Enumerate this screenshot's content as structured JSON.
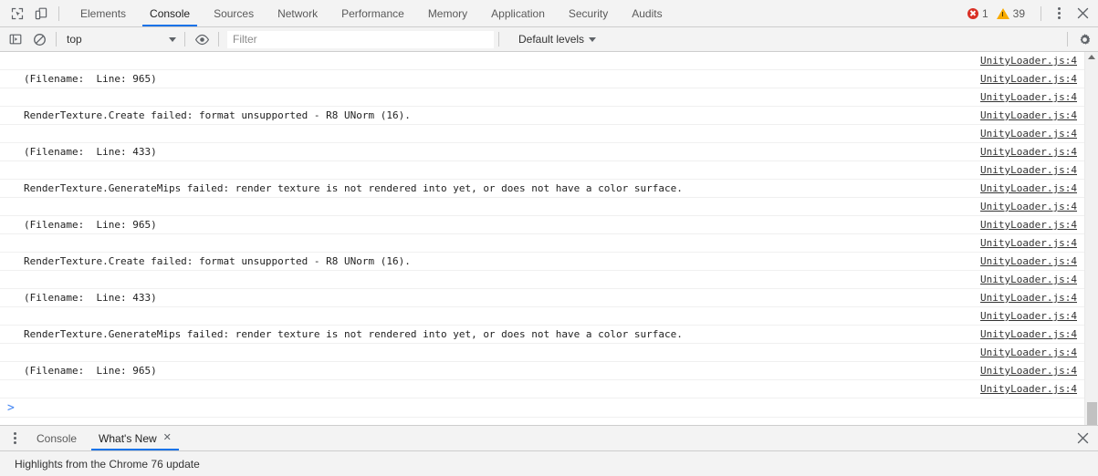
{
  "devtools": {
    "main_tabs": [
      {
        "label": "Elements",
        "active": false
      },
      {
        "label": "Console",
        "active": true
      },
      {
        "label": "Sources",
        "active": false
      },
      {
        "label": "Network",
        "active": false
      },
      {
        "label": "Performance",
        "active": false
      },
      {
        "label": "Memory",
        "active": false
      },
      {
        "label": "Application",
        "active": false
      },
      {
        "label": "Security",
        "active": false
      },
      {
        "label": "Audits",
        "active": false
      }
    ],
    "status": {
      "error_count": "1",
      "warning_count": "39",
      "error_color": "#d93025",
      "warning_color": "#f9ab00"
    },
    "icons": {
      "inspect": "inspect-element-icon",
      "device": "device-toolbar-icon",
      "more": "more-options-icon",
      "close": "close-devtools-icon"
    },
    "accent_color": "#1a73e8"
  },
  "console_toolbar": {
    "sidebar_toggle": "console-sidebar-toggle-icon",
    "clear_console": "clear-console-icon",
    "context": "top",
    "eye": "live-expression-icon",
    "filter_placeholder": "Filter",
    "filter_value": "",
    "levels_label": "Default levels",
    "settings": "settings-gear-icon"
  },
  "console_messages": {
    "source_link": "UnityLoader.js:4",
    "rows": [
      {
        "text": ""
      },
      {
        "text": "(Filename:  Line: 965)"
      },
      {
        "text": ""
      },
      {
        "text": "RenderTexture.Create failed: format unsupported - R8 UNorm (16)."
      },
      {
        "text": ""
      },
      {
        "text": "(Filename:  Line: 433)"
      },
      {
        "text": ""
      },
      {
        "text": "RenderTexture.GenerateMips failed: render texture is not rendered into yet, or does not have a color surface."
      },
      {
        "text": ""
      },
      {
        "text": "(Filename:  Line: 965)"
      },
      {
        "text": ""
      },
      {
        "text": "RenderTexture.Create failed: format unsupported - R8 UNorm (16)."
      },
      {
        "text": ""
      },
      {
        "text": "(Filename:  Line: 433)"
      },
      {
        "text": ""
      },
      {
        "text": "RenderTexture.GenerateMips failed: render texture is not rendered into yet, or does not have a color surface."
      },
      {
        "text": ""
      },
      {
        "text": "(Filename:  Line: 965)"
      },
      {
        "text": ""
      }
    ],
    "prompt_symbol": ">"
  },
  "drawer": {
    "menu_icon": "drawer-more-options-icon",
    "tabs": [
      {
        "label": "Console",
        "active": false,
        "closable": false
      },
      {
        "label": "What's New",
        "active": true,
        "closable": true
      }
    ],
    "close_symbol": "✕",
    "close_drawer": "close-drawer-icon",
    "note": "Highlights from the Chrome 76 update"
  }
}
